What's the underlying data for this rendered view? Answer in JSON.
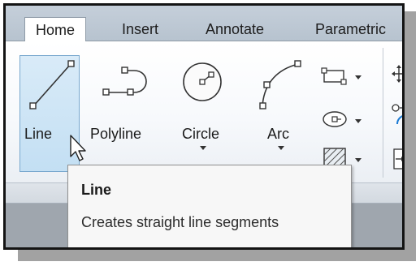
{
  "tabs": [
    {
      "label": "Home",
      "active": true
    },
    {
      "label": "Insert",
      "active": false
    },
    {
      "label": "Annotate",
      "active": false
    },
    {
      "label": "Parametric",
      "active": false
    }
  ],
  "tools": {
    "line": {
      "label": "Line",
      "icon": "line-icon",
      "selected": true
    },
    "polyline": {
      "label": "Polyline",
      "icon": "polyline-icon"
    },
    "circle": {
      "label": "Circle",
      "icon": "circle-icon",
      "dropdown": true
    },
    "arc": {
      "label": "Arc",
      "icon": "arc-icon",
      "dropdown": true
    }
  },
  "small_tools": [
    {
      "icon": "rectangle-icon",
      "dropdown": true
    },
    {
      "icon": "ellipse-icon",
      "dropdown": true
    },
    {
      "icon": "hatch-icon",
      "dropdown": true
    }
  ],
  "tooltip": {
    "title": "Line",
    "description": "Creates straight line segments"
  },
  "colors": {
    "selected_fill": "#c8e1f4",
    "selected_border": "#78a8ce",
    "tab_bar": "#bfcad6",
    "tooltip_bg": "#f7f7f7",
    "accent_blue": "#3b5f9e"
  }
}
